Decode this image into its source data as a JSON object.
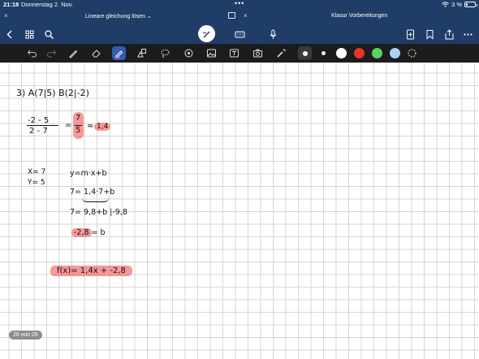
{
  "status_bar": {
    "time": "21:18",
    "date": "Donnerstag 2. Nov.",
    "multitask_dots": "•••",
    "battery_text": "3 %"
  },
  "tabs": [
    {
      "title": "Lineare gleichung lösen ⌄",
      "close": "×"
    },
    {
      "title": "Klasur Vorbereitungen",
      "close": "×"
    }
  ],
  "toolbar": {
    "icons": [
      "back-icon",
      "grid-icon",
      "search-icon",
      "pen-circle-icon",
      "keyboard-icon",
      "microphone-icon",
      "add-page-icon",
      "bookmark-icon",
      "share-icon",
      "more-icon"
    ]
  },
  "tools": {
    "icons": [
      "undo-icon",
      "redo-icon",
      "pen-icon",
      "eraser-icon",
      "highlighter-icon",
      "shapes-icon",
      "lasso-icon",
      "sticker-icon",
      "image-icon",
      "text-icon",
      "camera-icon",
      "laser-icon"
    ],
    "active": "highlighter-icon",
    "colors": [
      "#ffffff",
      "#ffffff",
      "#ffffff",
      "#e8342a",
      "#59d45c",
      "#a9d4f5"
    ]
  },
  "notes": {
    "line1": "3)   A(7|5)   B(2|-2)",
    "frac_num": "-2 - 5",
    "frac_den": "2 - 7",
    "equals": "=",
    "slope_num": "7",
    "slope_den": "5",
    "approx": "≈",
    "slope_result": "1,4",
    "x_val": "X= 7",
    "y_val": "Y= 5",
    "formula": "y=m·x+b",
    "step1": "7= 1,4·7+b",
    "step2": "7=   9,8+b  |-9,8",
    "step3_hl": "-2,8",
    "step3_rest": "= b",
    "final": "f(x)= 1,4x +  -2,8"
  },
  "page_indicator": "26 von 26"
}
